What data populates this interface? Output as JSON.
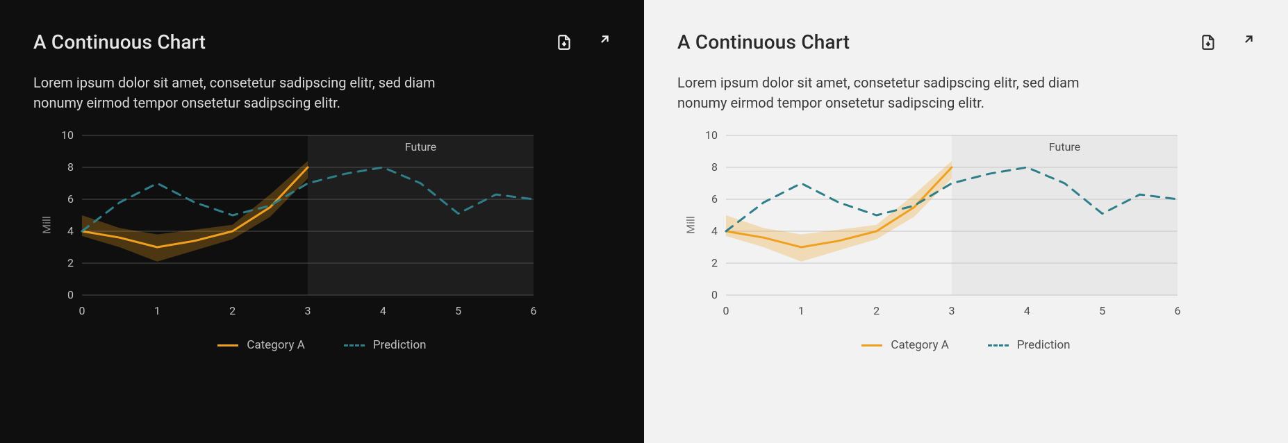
{
  "title": "A Continuous Chart",
  "description": "Lorem ipsum dolor sit amet, consetetur sadipscing elitr, sed diam nonumy eirmod tempor onsetetur sadipscing elitr.",
  "icons": {
    "download": "download-file-icon",
    "expand": "expand-icon"
  },
  "ylabel": "Mill",
  "future_label": "Future",
  "legend": {
    "a": "Category A",
    "b": "Prediction"
  },
  "chart_data": {
    "type": "line",
    "xlabel": "",
    "ylabel": "Mill",
    "title": "A Continuous Chart",
    "x_ticks": [
      0,
      1,
      2,
      3,
      4,
      5,
      6
    ],
    "y_ticks": [
      0,
      2,
      4,
      6,
      8,
      10
    ],
    "xlim": [
      0,
      6
    ],
    "ylim": [
      0,
      10
    ],
    "future_region": {
      "x_start": 3,
      "x_end": 6,
      "label": "Future"
    },
    "series": [
      {
        "name": "Category A",
        "style": "solid",
        "color": "#f0a020",
        "x": [
          0,
          0.5,
          1,
          1.5,
          2,
          2.5,
          3
        ],
        "values": [
          4,
          3.6,
          3.0,
          3.4,
          4.0,
          5.5,
          8.0
        ],
        "ci_low": [
          3.7,
          3.0,
          2.1,
          2.8,
          3.5,
          4.9,
          7.3
        ],
        "ci_high": [
          5.0,
          4.2,
          3.8,
          4.1,
          4.4,
          6.3,
          8.4
        ]
      },
      {
        "name": "Prediction",
        "style": "dashed",
        "color": "#2f7f8a",
        "x": [
          0,
          0.5,
          1,
          1.5,
          2,
          2.5,
          3,
          3.5,
          4,
          4.5,
          5,
          5.5,
          6
        ],
        "values": [
          4.0,
          5.8,
          7.0,
          5.8,
          5.0,
          5.6,
          7.0,
          7.6,
          8.0,
          7.0,
          5.1,
          6.3,
          6.0
        ]
      }
    ],
    "legend_position": "bottom",
    "grid": true,
    "variants": [
      "dark",
      "light"
    ]
  }
}
